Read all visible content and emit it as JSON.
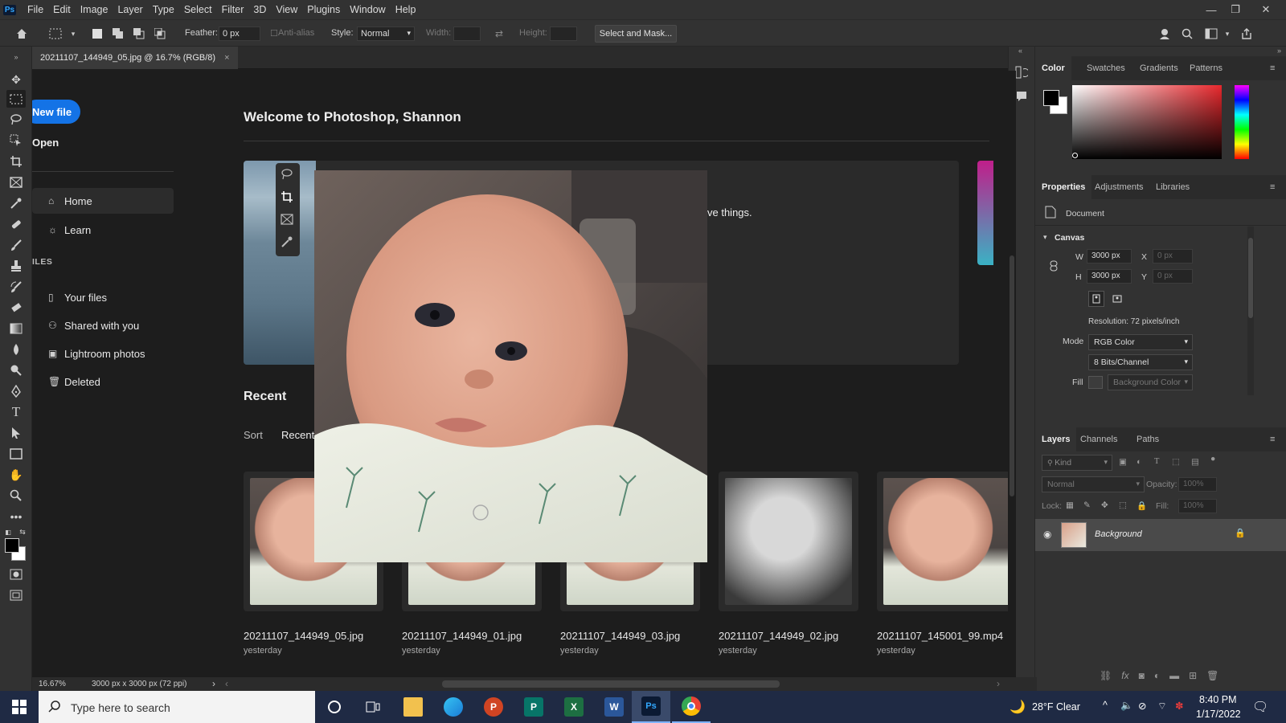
{
  "app": {
    "logo": "Ps"
  },
  "menu": [
    "File",
    "Edit",
    "Image",
    "Layer",
    "Type",
    "Select",
    "Filter",
    "3D",
    "View",
    "Plugins",
    "Window",
    "Help"
  ],
  "options": {
    "feather_label": "Feather:",
    "feather_value": "0 px",
    "antialias_label": "Anti-alias",
    "style_label": "Style:",
    "style_value": "Normal",
    "width_label": "Width:",
    "height_label": "Height:",
    "select_mask": "Select and Mask..."
  },
  "document": {
    "tab_title": "20211107_144949_05.jpg @ 16.7% (RGB/8)",
    "close": "×"
  },
  "home": {
    "new_file": "New file",
    "open": "Open",
    "welcome": "Welcome to Photoshop, Shannon",
    "banner_text": "ve things.",
    "nav": [
      {
        "label": "Home",
        "icon": "house-icon"
      },
      {
        "label": "Learn",
        "icon": "lightbulb-icon"
      }
    ],
    "files_header": "ILES",
    "files_nav": [
      {
        "label": "Your files",
        "icon": "file-icon"
      },
      {
        "label": "Shared with you",
        "icon": "shared-icon"
      },
      {
        "label": "Lightroom photos",
        "icon": "lightroom-icon"
      },
      {
        "label": "Deleted",
        "icon": "trash-icon"
      }
    ],
    "recent_title": "Recent",
    "sort_label": "Sort",
    "sort_value": "Recent",
    "recent_files": [
      {
        "name": "20211107_144949_05.jpg",
        "date": "yesterday",
        "tone": "color"
      },
      {
        "name": "20211107_144949_01.jpg",
        "date": "yesterday",
        "tone": "color"
      },
      {
        "name": "20211107_144949_03.jpg",
        "date": "yesterday",
        "tone": "color"
      },
      {
        "name": "20211107_144949_02.jpg",
        "date": "yesterday",
        "tone": "bw"
      },
      {
        "name": "20211107_145001_99.mp4",
        "date": "yesterday",
        "tone": "color"
      }
    ]
  },
  "color_panel": {
    "tabs": [
      "Color",
      "Swatches",
      "Gradients",
      "Patterns"
    ],
    "active": "Color",
    "base_hue": "#e8282d"
  },
  "properties_panel": {
    "tabs": [
      "Properties",
      "Adjustments",
      "Libraries"
    ],
    "active": "Properties",
    "doc_label": "Document",
    "canvas_label": "Canvas",
    "w_label": "W",
    "w_value": "3000 px",
    "h_label": "H",
    "h_value": "3000 px",
    "x_label": "X",
    "x_value": "0 px",
    "y_label": "Y",
    "y_value": "0 px",
    "resolution": "Resolution: 72 pixels/inch",
    "mode_label": "Mode",
    "mode_value": "RGB Color",
    "bits_value": "8 Bits/Channel",
    "fill_label": "Fill",
    "fill_value": "Background Color"
  },
  "layers_panel": {
    "tabs": [
      "Layers",
      "Channels",
      "Paths"
    ],
    "active": "Layers",
    "kind": "Kind",
    "blend": "Normal",
    "opacity_label": "Opacity:",
    "opacity_value": "100%",
    "lock_label": "Lock:",
    "fill_label": "Fill:",
    "fill_value": "100%",
    "layer_name": "Background"
  },
  "status": {
    "zoom": "16.67%",
    "doc_info": "3000 px x 3000 px (72 ppi)"
  },
  "taskbar": {
    "search_placeholder": "Type here to search",
    "weather": "28°F  Clear",
    "time": "8:40 PM",
    "date": "1/17/2022",
    "apps": [
      "File Explorer",
      "Edge",
      "PowerPoint",
      "Publisher",
      "Excel",
      "Word",
      "Photoshop",
      "Chrome"
    ]
  }
}
